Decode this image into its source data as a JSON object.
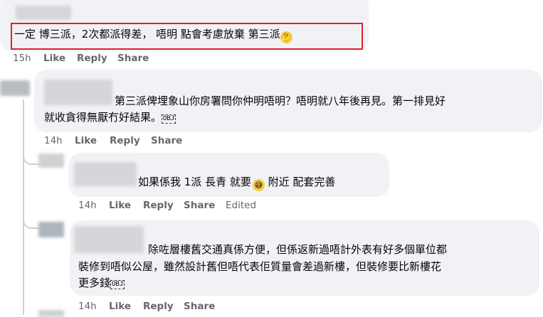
{
  "comments": [
    {
      "text": "一定 博三派，2次都派得差， 唔明 點會考慮放棄 第三派",
      "emoji": "thinking-face",
      "emoji_glyph": "🤔",
      "time": "15h",
      "like": "Like",
      "reply": "Reply",
      "share": "Share"
    },
    {
      "line1": "第三派俾埋象山你房署問你仲明唔明？唔明就八年後再見。第一排見好",
      "line2": "就收貪得無厭冇好結果。",
      "badge": "OBJ",
      "time": "14h",
      "like": "Like",
      "reply": "Reply",
      "share": "Share"
    },
    {
      "text_a": "如果係我 1派 長青 就要",
      "emoji": "grinning-sweat-face",
      "emoji_glyph": "😅",
      "text_b": " 附近 配套完善",
      "time": "14h",
      "like": "Like",
      "reply": "Reply",
      "share": "Share",
      "edited": "Edited"
    },
    {
      "line1": "除咗層樓舊交通真係方便，但係返新過唔計外表有好多個單位都",
      "line2": "裝修到唔似公屋，雖然設計舊但唔代表佢質量會差過新樓，但裝修要比新樓花",
      "line3": "更多錢",
      "badge": "OBJ",
      "time": "14h",
      "like": "Like",
      "reply": "Reply",
      "share": "Share"
    }
  ],
  "colors": {
    "highlight": "#e0202b",
    "bubble": "#f0f2f5",
    "meta": "#65676b"
  }
}
